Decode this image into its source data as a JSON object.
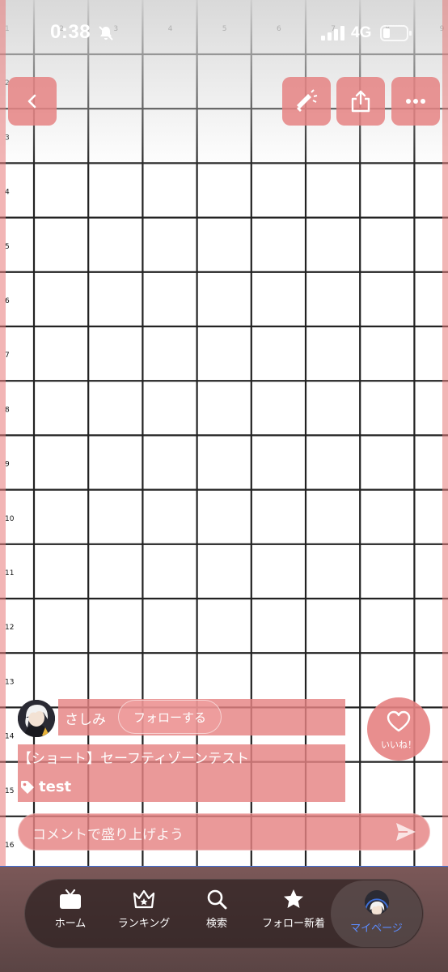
{
  "status_bar": {
    "time": "0:38",
    "network": "4G"
  },
  "grid": {
    "row_labels": [
      "1",
      "2",
      "3",
      "4",
      "5",
      "6",
      "7",
      "8",
      "9",
      "10",
      "11",
      "12",
      "13",
      "14",
      "15",
      "16"
    ],
    "column_labels": [
      "1",
      "2",
      "3",
      "4",
      "5",
      "6",
      "7",
      "8",
      "9"
    ]
  },
  "colors": {
    "overlay_pink": "#e58282",
    "active_tab": "#5b8cff",
    "grid_line": "#222222"
  },
  "video": {
    "user_name": "さしみ",
    "follow_label": "フォローする",
    "title": "【ショート】セーフティゾーンテスト",
    "tag": "test",
    "like_label": "いいね！",
    "comment_placeholder": "コメントで盛り上げよう"
  },
  "top_actions": {
    "icons": [
      "back-icon",
      "megaphone-icon",
      "share-icon",
      "more-icon"
    ]
  },
  "tabbar": {
    "tabs": [
      {
        "label": "ホーム",
        "icon": "tv-icon"
      },
      {
        "label": "ランキング",
        "icon": "crown-icon"
      },
      {
        "label": "検索",
        "icon": "search-icon"
      },
      {
        "label": "フォロー新着",
        "icon": "star-icon"
      },
      {
        "label": "マイページ",
        "icon": "avatar-icon",
        "active": true
      }
    ]
  }
}
